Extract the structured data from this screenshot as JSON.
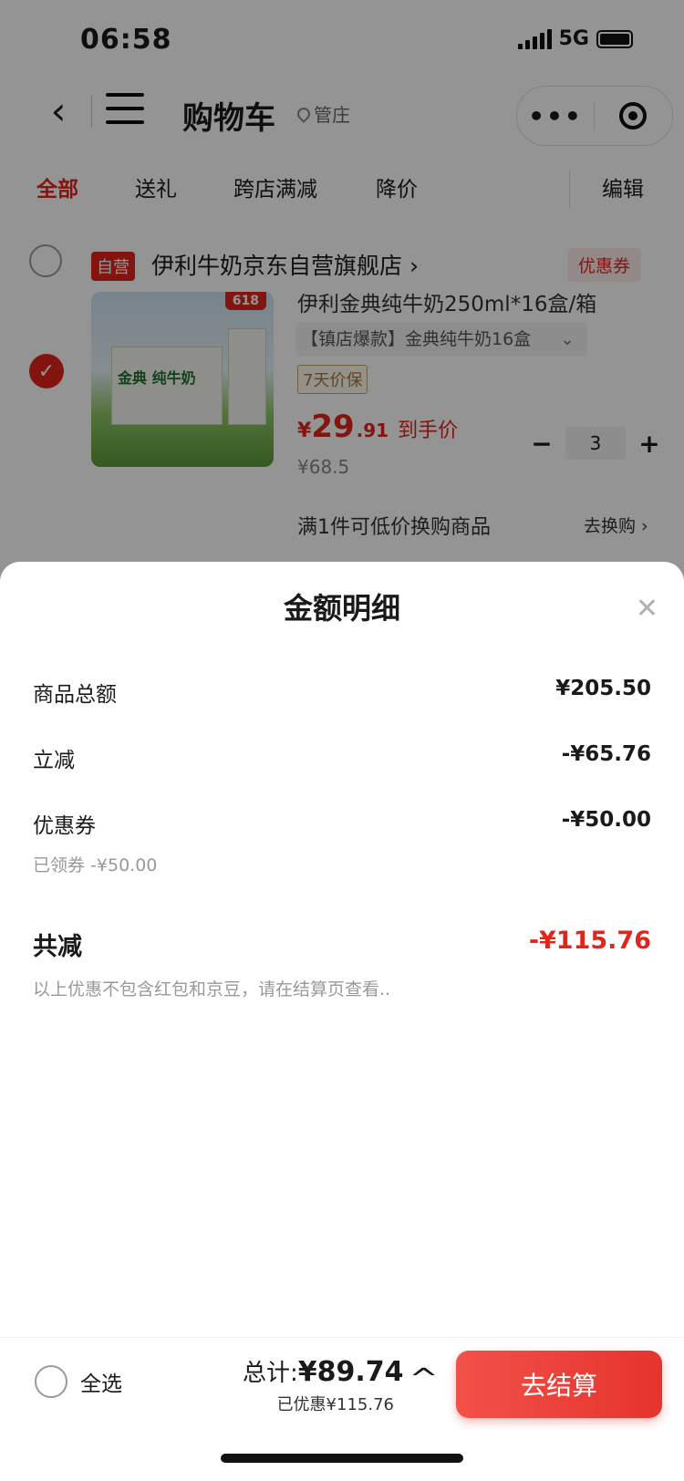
{
  "status_bar": {
    "time": "06:58",
    "network": "5G"
  },
  "nav": {
    "title": "购物车",
    "location": "管庄"
  },
  "tabs": [
    "全部",
    "送礼",
    "跨店满减",
    "降价"
  ],
  "edit_label": "编辑",
  "store": {
    "self_tag": "自营",
    "name": "伊利牛奶京东自营旗舰店 ›",
    "coupon_label": "优惠券"
  },
  "product": {
    "badge": "618",
    "image_text": "金典 纯牛奶",
    "title": "伊利金典纯牛奶250ml*16盒/箱",
    "sku": "【镇店爆款】金典纯牛奶16盒",
    "price_protect": "7天价保",
    "price_symbol": "¥",
    "price_int": "29",
    "price_dec": ".91",
    "price_label": "到手价",
    "old_price": "¥68.5",
    "quantity": "3",
    "swap_text": "满1件可低价换购商品",
    "swap_link": "去换购 ›"
  },
  "sheet": {
    "title": "金额明细",
    "rows": [
      {
        "label": "商品总额",
        "amount": "¥205.50"
      },
      {
        "label": "立减",
        "amount": "-¥65.76"
      },
      {
        "label": "优惠券",
        "amount": "-¥50.00"
      }
    ],
    "coupon_note": "已领券 -¥50.00",
    "total_label": "共减",
    "total_amount": "-¥115.76",
    "footnote": "以上优惠不包含红包和京豆，请在结算页查看.."
  },
  "bottom": {
    "select_all": "全选",
    "total_label": "总计:",
    "total_value": "¥89.74",
    "saved": "已优惠¥115.76",
    "checkout": "去结算"
  },
  "colors": {
    "accent": "#e1251b",
    "overlay": "rgba(0,0,0,0.42)"
  }
}
